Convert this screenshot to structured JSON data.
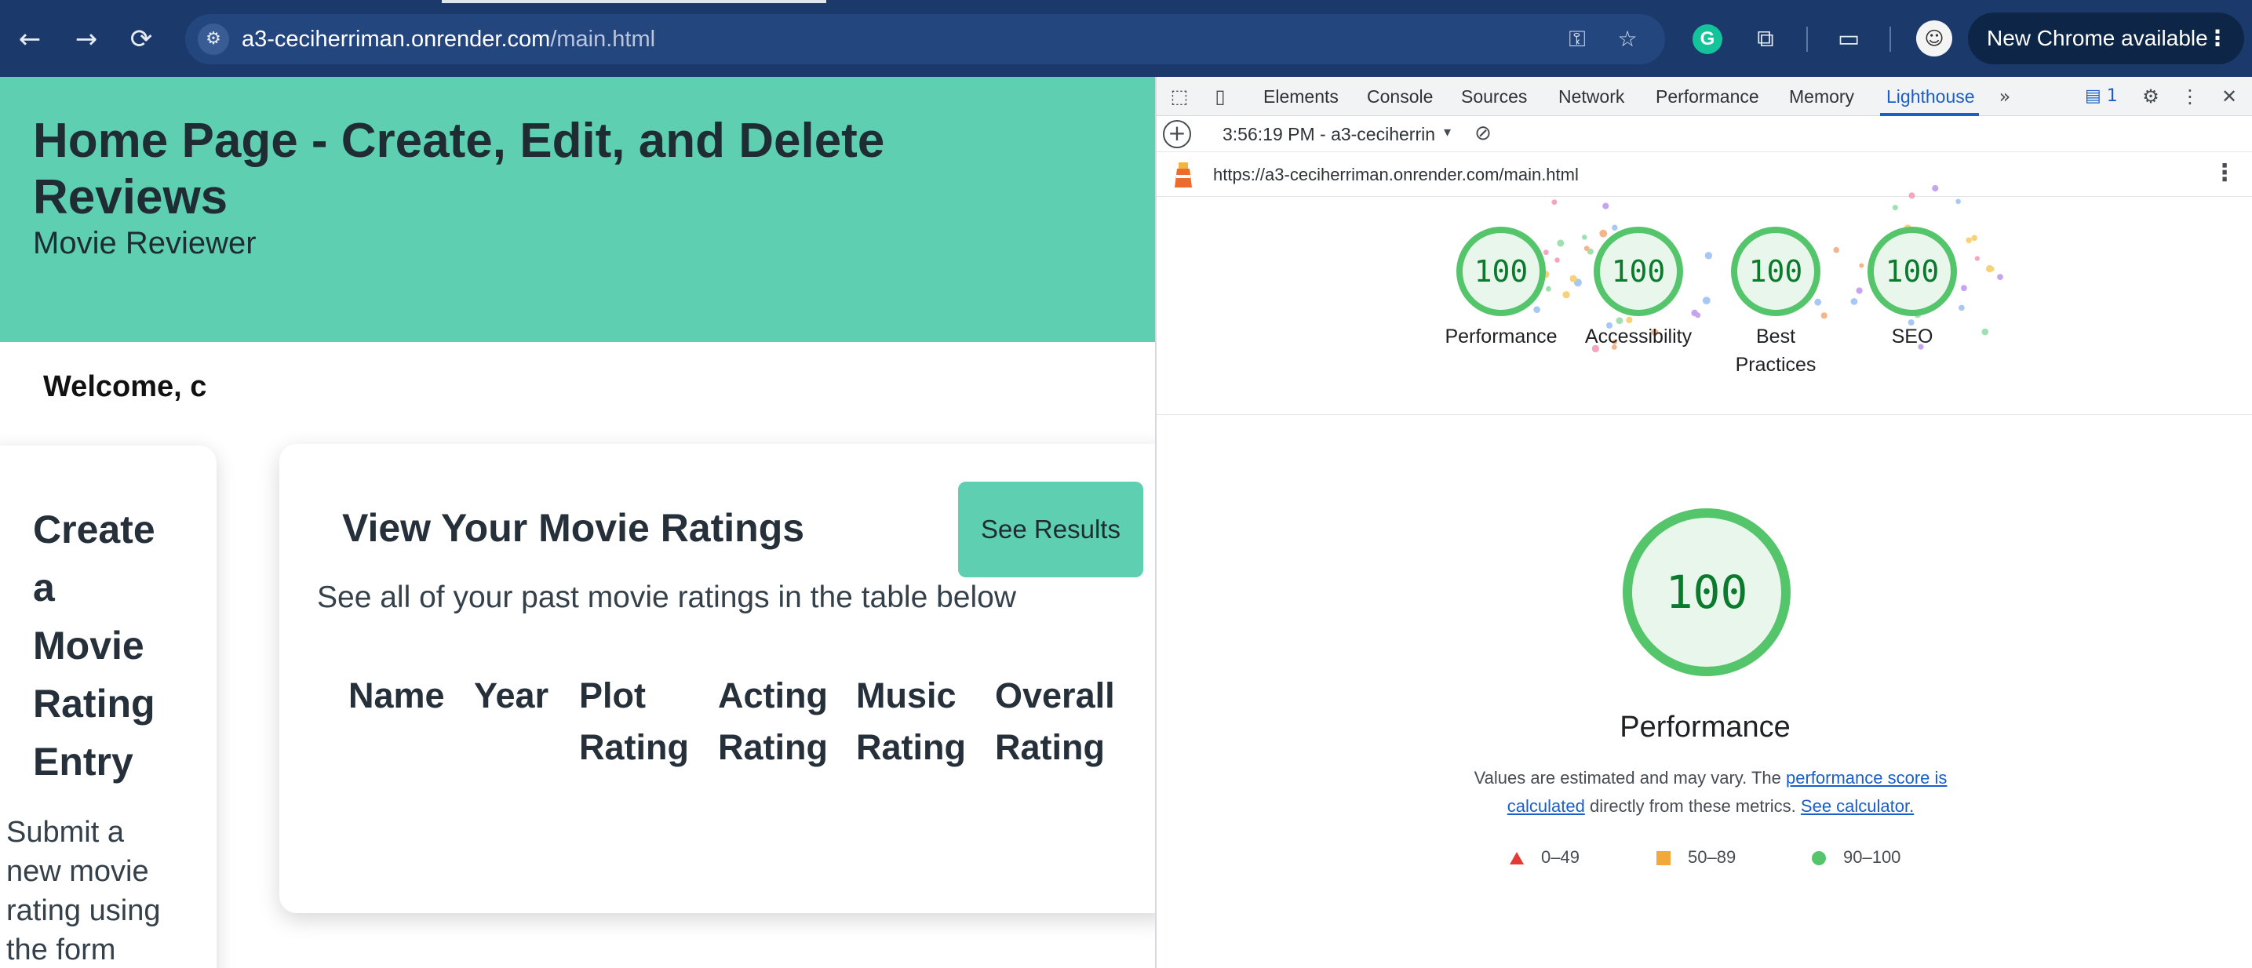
{
  "browser": {
    "url_host": "a3-ceciherriman.onrender.com",
    "url_path": "/main.html",
    "update_label": "New Chrome available",
    "icons": {
      "back": "←",
      "forward": "→",
      "reload": "⟳",
      "site_info": "⚙",
      "password": "⚿",
      "bookmark": "☆",
      "grammarly": "G",
      "extensions": "⧉",
      "cast": "▭",
      "avatar": "☺",
      "kebab": "⋮"
    }
  },
  "page": {
    "hero_title": "Home Page - Create, Edit, and Delete Reviews",
    "hero_subtitle": "Movie Reviewer",
    "welcome": "Welcome, c",
    "create_card": {
      "title_lines": [
        "Create",
        "a",
        "Movie",
        "Rating",
        "Entry"
      ],
      "desc_lines": [
        "Submit a",
        "new movie",
        "rating using",
        "the form"
      ]
    },
    "view_card": {
      "title": "View Your Movie Ratings",
      "button": "See Results",
      "description": "See all of your past movie ratings in the table below",
      "columns": [
        [
          "Name"
        ],
        [
          "Year"
        ],
        [
          "Plot",
          "Rating"
        ],
        [
          "Acting",
          "Rating"
        ],
        [
          "Music",
          "Rating"
        ],
        [
          "Overall",
          "Rating"
        ]
      ]
    }
  },
  "devtools": {
    "tabs": [
      "Elements",
      "Console",
      "Sources",
      "Network",
      "Performance",
      "Memory",
      "Lighthouse"
    ],
    "active_tab": "Lighthouse",
    "more_tabs": "»",
    "issues_count": "1",
    "report_label": "3:56:19 PM - a3-ceciherrin",
    "report_url": "https://a3-ceciherriman.onrender.com/main.html",
    "gauges": [
      {
        "score": "100",
        "label_lines": [
          "Performance"
        ]
      },
      {
        "score": "100",
        "label_lines": [
          "Accessibility"
        ]
      },
      {
        "score": "100",
        "label_lines": [
          "Best",
          "Practices"
        ]
      },
      {
        "score": "100",
        "label_lines": [
          "SEO"
        ]
      }
    ],
    "main_score": "100",
    "main_title": "Performance",
    "desc_prefix": "Values are estimated and may vary. The ",
    "desc_link1": "performance score is calculated",
    "desc_middle": " directly from these metrics. ",
    "desc_link2": "See calculator.",
    "legend": [
      "0–49",
      "50–89",
      "90–100"
    ],
    "colors": {
      "pass": "#55c56c",
      "average": "#f0a93a",
      "fail": "#e53935",
      "accent": "#1a5fc9",
      "brand": "#5fcfb2"
    }
  }
}
